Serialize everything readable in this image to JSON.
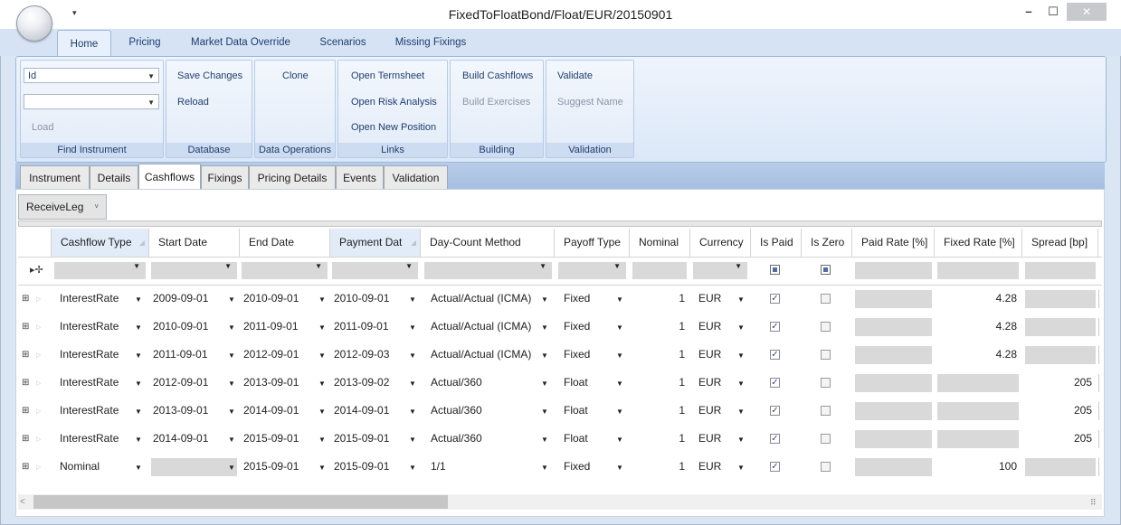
{
  "window": {
    "title": "FixedToFloatBond/Float/EUR/20150901",
    "qat_icon": "dropdown-arrow-icon",
    "minimize_icon": "minimize-icon",
    "maximize_icon": "maximize-icon",
    "close_icon": "close-icon"
  },
  "ribbon": {
    "tabs": [
      {
        "label": "Home",
        "active": true
      },
      {
        "label": "Pricing"
      },
      {
        "label": "Market Data Override"
      },
      {
        "label": "Scenarios"
      },
      {
        "label": "Missing Fixings"
      }
    ],
    "find_instrument": {
      "field_combo_value": "Id",
      "value_combo_value": "",
      "load_label": "Load",
      "group_label": "Find Instrument"
    },
    "database": {
      "save_label": "Save Changes",
      "reload_label": "Reload",
      "group_label": "Database"
    },
    "data_operations": {
      "clone_label": "Clone",
      "group_label": "Data Operations"
    },
    "links": {
      "termsheet_label": "Open Termsheet",
      "risk_label": "Open Risk Analysis",
      "position_label": "Open New Position",
      "group_label": "Links"
    },
    "building": {
      "cashflows_label": "Build Cashflows",
      "exercises_label": "Build Exercises",
      "group_label": "Building"
    },
    "validation": {
      "validate_label": "Validate",
      "suggest_label": "Suggest Name",
      "group_label": "Validation"
    }
  },
  "doc_tabs": [
    {
      "label": "Instrument"
    },
    {
      "label": "Details"
    },
    {
      "label": "Cashflows",
      "active": true
    },
    {
      "label": "Fixings"
    },
    {
      "label": "Pricing Details"
    },
    {
      "label": "Events"
    },
    {
      "label": "Validation"
    }
  ],
  "leg_select": {
    "value": "ReceiveLeg"
  },
  "grid": {
    "columns": [
      "Cashflow Type",
      "Start Date",
      "End Date",
      "Payment Dat",
      "Day-Count Method",
      "Payoff Type",
      "Nominal",
      "Currency",
      "Is Paid",
      "Is Zero",
      "Paid Rate [%]",
      "Fixed Rate [%]",
      "Spread [bp]"
    ],
    "rows": [
      {
        "type": "InterestRate",
        "start": "2009-09-01",
        "end": "2010-09-01",
        "pay": "2010-09-01",
        "dcm": "Actual/Actual (ICMA)",
        "payoff": "Fixed",
        "nominal": "1",
        "ccy": "EUR",
        "paid": true,
        "zero": false,
        "fixed_rate": "4.28",
        "spread": ""
      },
      {
        "type": "InterestRate",
        "start": "2010-09-01",
        "end": "2011-09-01",
        "pay": "2011-09-01",
        "dcm": "Actual/Actual (ICMA)",
        "payoff": "Fixed",
        "nominal": "1",
        "ccy": "EUR",
        "paid": true,
        "zero": false,
        "fixed_rate": "4.28",
        "spread": ""
      },
      {
        "type": "InterestRate",
        "start": "2011-09-01",
        "end": "2012-09-01",
        "pay": "2012-09-03",
        "dcm": "Actual/Actual (ICMA)",
        "payoff": "Fixed",
        "nominal": "1",
        "ccy": "EUR",
        "paid": true,
        "zero": false,
        "fixed_rate": "4.28",
        "spread": ""
      },
      {
        "type": "InterestRate",
        "start": "2012-09-01",
        "end": "2013-09-01",
        "pay": "2013-09-02",
        "dcm": "Actual/360",
        "payoff": "Float",
        "nominal": "1",
        "ccy": "EUR",
        "paid": true,
        "zero": false,
        "fixed_rate": "",
        "spread": "205"
      },
      {
        "type": "InterestRate",
        "start": "2013-09-01",
        "end": "2014-09-01",
        "pay": "2014-09-01",
        "dcm": "Actual/360",
        "payoff": "Float",
        "nominal": "1",
        "ccy": "EUR",
        "paid": true,
        "zero": false,
        "fixed_rate": "",
        "spread": "205"
      },
      {
        "type": "InterestRate",
        "start": "2014-09-01",
        "end": "2015-09-01",
        "pay": "2015-09-01",
        "dcm": "Actual/360",
        "payoff": "Float",
        "nominal": "1",
        "ccy": "EUR",
        "paid": true,
        "zero": false,
        "fixed_rate": "",
        "spread": "205"
      },
      {
        "type": "Nominal",
        "start": "",
        "end": "2015-09-01",
        "pay": "2015-09-01",
        "dcm": "1/1",
        "payoff": "Fixed",
        "nominal": "1",
        "ccy": "EUR",
        "paid": true,
        "zero": false,
        "fixed_rate": "100",
        "spread": ""
      }
    ]
  },
  "glyphs": {
    "expand": "⊞",
    "row_pointer": "▷",
    "chevron": "▼",
    "check": "✓",
    "scroll_left": "<",
    "grip": "⠿"
  },
  "colors": {
    "accent": "#1f3d6e",
    "ribbon": "#dbe8f8",
    "tab_strip": "#a6bfe2",
    "disabled_cell": "#d9d9d9"
  }
}
